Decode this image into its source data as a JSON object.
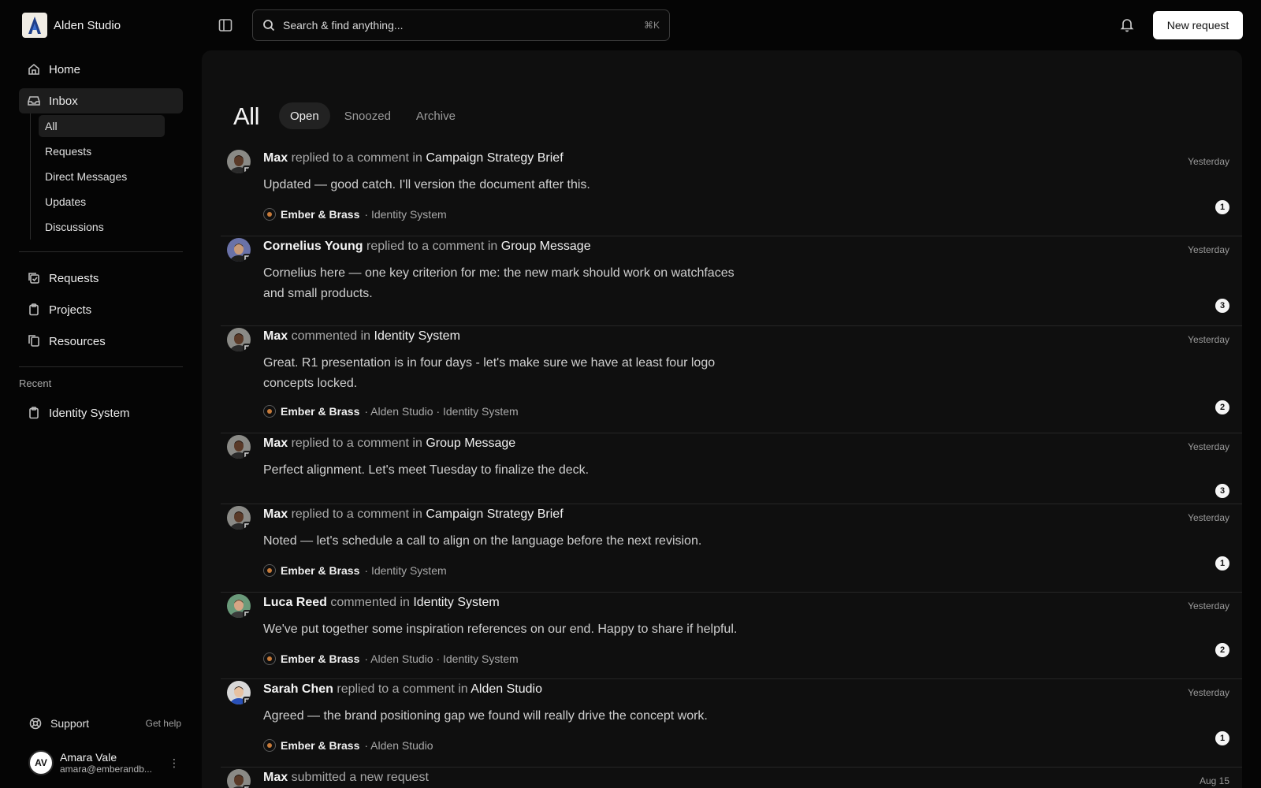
{
  "app": {
    "name": "Alden Studio",
    "logo_icon": "alden-logo"
  },
  "sidebar": {
    "home": "Home",
    "inbox": "Inbox",
    "inbox_sub": [
      "All",
      "Requests",
      "Direct Messages",
      "Updates",
      "Discussions"
    ],
    "requests": "Requests",
    "projects": "Projects",
    "resources": "Resources",
    "recent_label": "Recent",
    "recent_item": "Identity System",
    "support": "Support",
    "get_help": "Get help"
  },
  "user": {
    "initials": "AV",
    "name": "Amara Vale",
    "email": "amara@emberandb..."
  },
  "topbar": {
    "search_placeholder": "Search & find anything...",
    "search_shortcut": "⌘K",
    "new_request": "New request"
  },
  "page": {
    "title": "All",
    "tabs": [
      "Open",
      "Snoozed",
      "Archive"
    ],
    "active_tab": "Open"
  },
  "items": [
    {
      "who": "Max",
      "action": "replied to a comment in",
      "where": "Campaign Strategy Brief",
      "message": "Updated — good catch. I'll version the document after this.",
      "client": "Ember & Brass",
      "tags": "· Identity System",
      "time": "Yesterday",
      "count": "1",
      "avatar": "max"
    },
    {
      "who": "Cornelius Young",
      "action": "replied to a comment in",
      "where": "Group Message",
      "message": "Cornelius here — one key criterion for me: the new mark should work on watchfaces and small products.",
      "client": "",
      "tags": "",
      "time": "Yesterday",
      "count": "3",
      "avatar": "cornelius"
    },
    {
      "who": "Max",
      "action": "commented in",
      "where": "Identity System",
      "message": "Great. R1 presentation is in four days - let's make sure we have at least four logo concepts locked.",
      "client": "Ember & Brass",
      "tags": "· Alden Studio · Identity System",
      "time": "Yesterday",
      "count": "2",
      "avatar": "max"
    },
    {
      "who": "Max",
      "action": "replied to a comment in",
      "where": "Group Message",
      "message": "Perfect alignment. Let's meet Tuesday to finalize the deck.",
      "client": "",
      "tags": "",
      "time": "Yesterday",
      "count": "3",
      "avatar": "max"
    },
    {
      "who": "Max",
      "action": "replied to a comment in",
      "where": "Campaign Strategy Brief",
      "message": "Noted — let's schedule a call to align on the language before the next revision.",
      "client": "Ember & Brass",
      "tags": "· Identity System",
      "time": "Yesterday",
      "count": "1",
      "avatar": "max"
    },
    {
      "who": "Luca Reed",
      "action": "commented in",
      "where": "Identity System",
      "message": "We've put together some inspiration references on our end. Happy to share if helpful.",
      "client": "Ember & Brass",
      "tags": "· Alden Studio · Identity System",
      "time": "Yesterday",
      "count": "2",
      "avatar": "luca"
    },
    {
      "who": "Sarah Chen",
      "action": "replied to a comment in",
      "where": "Alden Studio",
      "message": "Agreed — the brand positioning gap we found will really drive the concept work.",
      "client": "Ember & Brass",
      "tags": "· Alden Studio",
      "time": "Yesterday",
      "count": "1",
      "avatar": "sarah"
    },
    {
      "who": "Max",
      "action": "submitted a new request",
      "where": "",
      "message": "",
      "client": "",
      "tags": "",
      "time": "Aug 15",
      "count": "",
      "avatar": "max"
    }
  ]
}
